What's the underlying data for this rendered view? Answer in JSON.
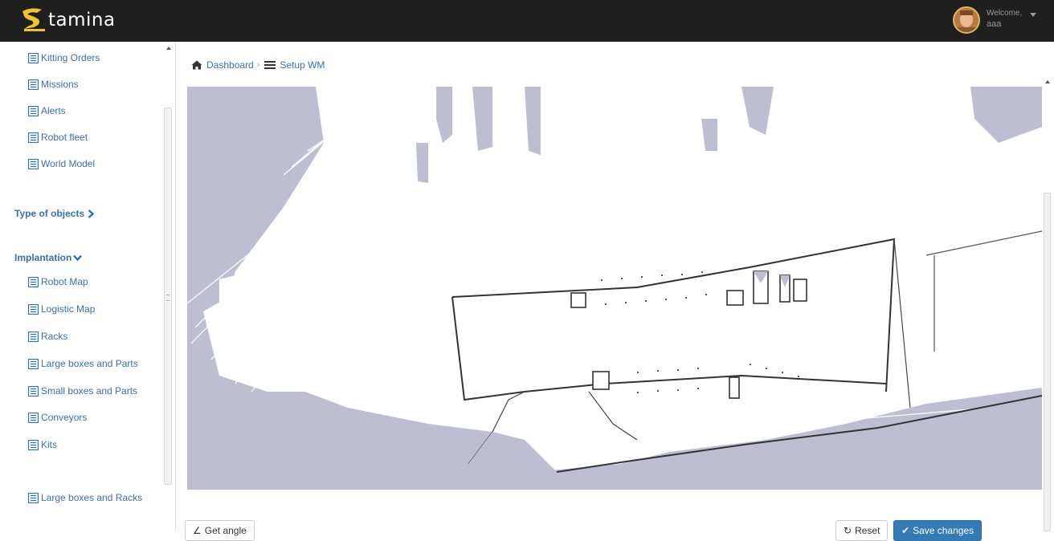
{
  "app": {
    "logo_text": "tamina",
    "user": {
      "welcome": "Welcome,",
      "name": "aaa"
    }
  },
  "sidebar": {
    "items_top": [
      {
        "label": "Kitting Orders"
      },
      {
        "label": "Missions"
      },
      {
        "label": "Alerts"
      },
      {
        "label": "Robot fleet"
      },
      {
        "label": "World Model"
      }
    ],
    "section_type": {
      "label": "Type of objects",
      "state": "collapsed"
    },
    "section_implantation": {
      "label": "Implantation",
      "state": "expanded"
    },
    "items_implantation": [
      {
        "label": "Robot Map"
      },
      {
        "label": "Logistic Map"
      },
      {
        "label": "Racks"
      },
      {
        "label": "Large boxes and Parts"
      },
      {
        "label": "Small boxes and Parts"
      },
      {
        "label": "Conveyors"
      },
      {
        "label": "Kits"
      }
    ],
    "item_bottom": {
      "label": "Large boxes and Racks"
    }
  },
  "breadcrumb": {
    "home": {
      "label": "Dashboard",
      "icon": "home-icon"
    },
    "current": {
      "label": "Setup WM",
      "icon": "bars-icon"
    }
  },
  "map": {
    "background_color": "#bebed2",
    "floor_color": "#ffffff"
  },
  "buttons": {
    "get_angle": {
      "label": "Get angle"
    },
    "reset": {
      "label": "Reset"
    },
    "save": {
      "label": "Save changes"
    }
  },
  "colors": {
    "topbar": "#1f1f1f",
    "link": "#3a6fb0",
    "primary": "#337ab7"
  }
}
